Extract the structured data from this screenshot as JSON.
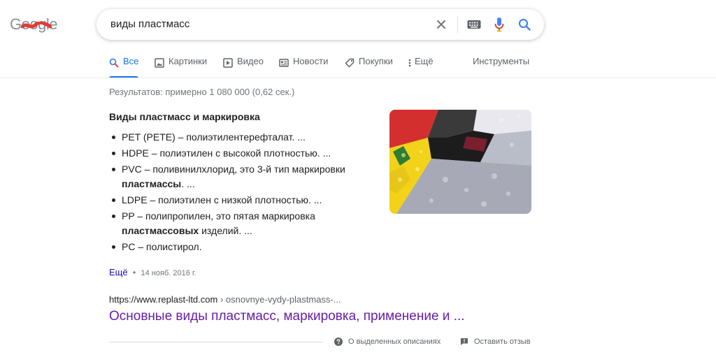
{
  "logo": {
    "text": "Google"
  },
  "search": {
    "query": "виды пластмасс"
  },
  "tabs": [
    {
      "label": "Все",
      "icon": "search-icon",
      "active": true
    },
    {
      "label": "Картинки",
      "icon": "image-icon"
    },
    {
      "label": "Видео",
      "icon": "video-icon"
    },
    {
      "label": "Новости",
      "icon": "news-icon"
    },
    {
      "label": "Покупки",
      "icon": "tag-icon"
    },
    {
      "label": "Ещё",
      "icon": "more-vert-icon"
    }
  ],
  "tools_label": "Инструменты",
  "stats": "Результатов: примерно 1 080 000 (0,62 сек.)",
  "snippet": {
    "title": "Виды пластмасс и маркировка",
    "items": [
      {
        "text": "PET (PETE) – полиэтилентерефталат. ..."
      },
      {
        "text": "HDPE – полиэтилен с высокой плотностью. ..."
      },
      {
        "text": "PVC – поливинилхлорид, это 3-й тип маркировки ",
        "bold": "пластмассы",
        "after": ". ..."
      },
      {
        "text": "LDPE – полиэтилен с низкой плотностью. ..."
      },
      {
        "text": "PP – полипропилен, это пятая маркировка ",
        "bold": "пластмассовых",
        "after": " изделий. ..."
      },
      {
        "text": "PC – полистирол."
      }
    ],
    "more_label": "Ещё",
    "date": "14 нояб. 2016 г."
  },
  "result": {
    "url": "https://www.replast-ltd.com",
    "breadcrumb": " › osnovnye-vydy-plastmass-...",
    "title": "Основные виды пластмасс, маркировка, применение и ..."
  },
  "footer": {
    "about_label": "О выделенных описаниях",
    "feedback_label": "Оставить отзыв"
  },
  "colors": {
    "accent": "#1a73e8",
    "visited_link": "#681da8",
    "link": "#1a0dab"
  }
}
